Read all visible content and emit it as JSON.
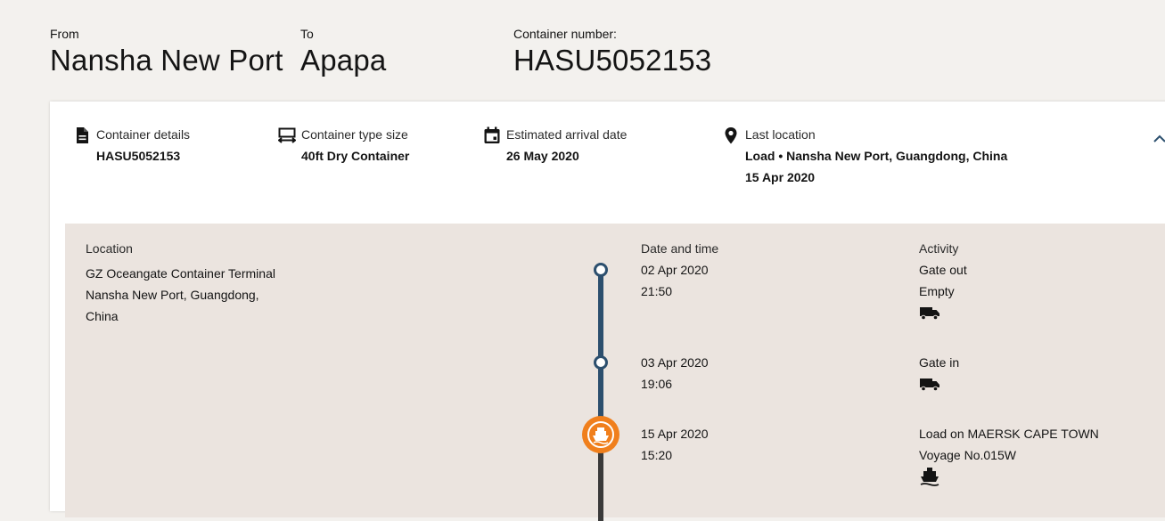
{
  "route": {
    "from_label": "From",
    "from_value": "Nansha New Port",
    "to_label": "To",
    "to_value": "Apapa",
    "container_label": "Container number:",
    "container_value": "HASU5052153"
  },
  "summary": {
    "details": {
      "icon": "document-icon",
      "label": "Container details",
      "value": "HASU5052153"
    },
    "type": {
      "icon": "container-type-icon",
      "label": "Container type size",
      "value": "40ft Dry Container"
    },
    "eta": {
      "icon": "calendar-icon",
      "label": "Estimated arrival date",
      "value": "26 May 2020"
    },
    "last_location": {
      "icon": "location-pin-icon",
      "label": "Last location",
      "value": "Load • Nansha New Port, Guangdong, China",
      "date": "15 Apr 2020"
    }
  },
  "timeline": {
    "headers": {
      "location": "Location",
      "datetime": "Date and time",
      "activity": "Activity"
    },
    "location": {
      "line1": "GZ Oceangate Container Terminal",
      "line2": "Nansha New Port, Guangdong,",
      "line3": "China"
    },
    "events": [
      {
        "date": "02 Apr 2020",
        "time": "21:50",
        "activity": "Gate out",
        "activity2": "Empty",
        "icon": "truck-icon"
      },
      {
        "date": "03 Apr 2020",
        "time": "19:06",
        "activity": "Gate in",
        "activity2": "",
        "icon": "truck-icon"
      },
      {
        "date": "15 Apr 2020",
        "time": "15:20",
        "activity": "Load on MAERSK CAPE TOWN",
        "activity2": "Voyage No.015W",
        "icon": "ship-icon"
      }
    ]
  },
  "colors": {
    "timeline_past": "#2c4f6e",
    "timeline_current": "#f07f1c",
    "timeline_future": "#3a3a3a",
    "panel_bg": "#ebe4df"
  }
}
